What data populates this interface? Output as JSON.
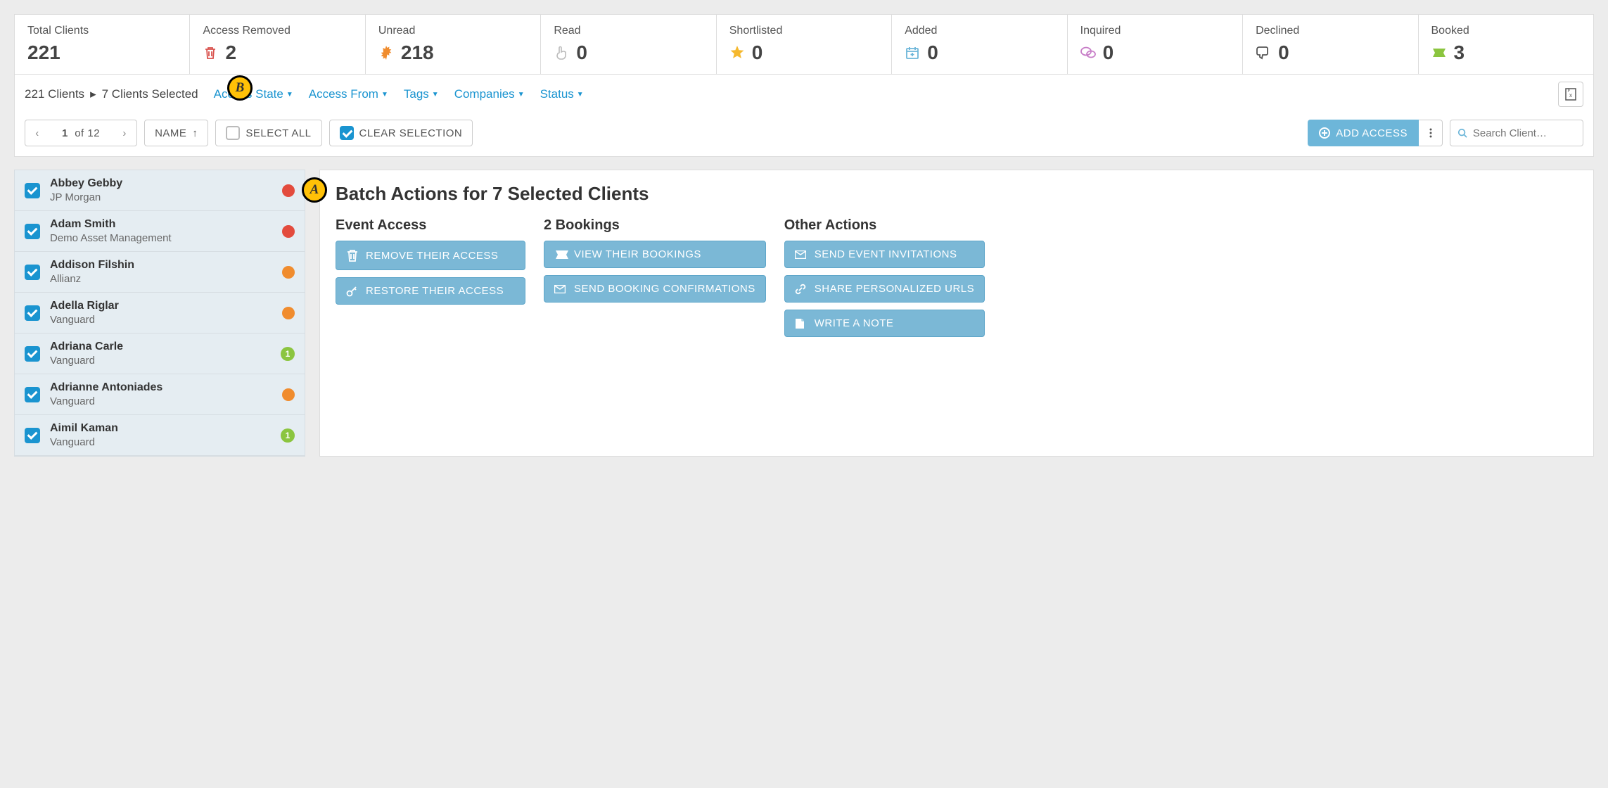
{
  "stats": [
    {
      "label": "Total Clients",
      "value": "221",
      "icon": null,
      "color": null
    },
    {
      "label": "Access Removed",
      "value": "2",
      "icon": "trash-icon",
      "color": "#d9534f"
    },
    {
      "label": "Unread",
      "value": "218",
      "icon": "burst-icon",
      "color": "#f08c2e"
    },
    {
      "label": "Read",
      "value": "0",
      "icon": "pointer-icon",
      "color": "#bbb"
    },
    {
      "label": "Shortlisted",
      "value": "0",
      "icon": "star-icon",
      "color": "#f5b82e"
    },
    {
      "label": "Added",
      "value": "0",
      "icon": "calendar-add-icon",
      "color": "#6db6d9"
    },
    {
      "label": "Inquired",
      "value": "0",
      "icon": "chat-icon",
      "color": "#c77dc7"
    },
    {
      "label": "Declined",
      "value": "0",
      "icon": "thumbs-down-icon",
      "color": "#555"
    },
    {
      "label": "Booked",
      "value": "3",
      "icon": "ticket-icon",
      "color": "#8bc53f"
    }
  ],
  "breadcrumb": {
    "total": "221 Clients",
    "selected": "7 Clients Selected"
  },
  "filters": [
    "Access State",
    "Access From",
    "Tags",
    "Companies",
    "Status"
  ],
  "pager": {
    "page": "1",
    "of": "of 12"
  },
  "sort": {
    "label": "NAME"
  },
  "select_all": "SELECT ALL",
  "clear_selection": "CLEAR SELECTION",
  "add_access": "ADD ACCESS",
  "search_placeholder": "Search Client…",
  "clients": [
    {
      "name": "Abbey Gebby",
      "company": "JP Morgan",
      "status_color": "#e34b3d",
      "badge": null
    },
    {
      "name": "Adam Smith",
      "company": "Demo Asset Management",
      "status_color": "#e34b3d",
      "badge": null
    },
    {
      "name": "Addison Filshin",
      "company": "Allianz",
      "status_color": "#f08c2e",
      "badge": null
    },
    {
      "name": "Adella Riglar",
      "company": "Vanguard",
      "status_color": "#f08c2e",
      "badge": null
    },
    {
      "name": "Adriana Carle",
      "company": "Vanguard",
      "status_color": null,
      "badge": "1"
    },
    {
      "name": "Adrianne Antoniades",
      "company": "Vanguard",
      "status_color": "#f08c2e",
      "badge": null
    },
    {
      "name": "Aimil Kaman",
      "company": "Vanguard",
      "status_color": null,
      "badge": "1"
    }
  ],
  "batch": {
    "title": "Batch Actions for 7 Selected Clients",
    "cols": [
      {
        "title": "Event Access",
        "buttons": [
          {
            "icon": "trash-icon",
            "label": "REMOVE THEIR ACCESS"
          },
          {
            "icon": "key-icon",
            "label": "RESTORE THEIR ACCESS"
          }
        ]
      },
      {
        "title": "2 Bookings",
        "buttons": [
          {
            "icon": "ticket-icon",
            "label": "VIEW THEIR BOOKINGS"
          },
          {
            "icon": "envelope-icon",
            "label": "SEND BOOKING CONFIRMATIONS"
          }
        ]
      },
      {
        "title": "Other Actions",
        "buttons": [
          {
            "icon": "envelope-icon",
            "label": "SEND EVENT INVITATIONS"
          },
          {
            "icon": "link-icon",
            "label": "SHARE PERSONALIZED URLS"
          },
          {
            "icon": "note-icon",
            "label": "WRITE A NOTE"
          }
        ]
      }
    ]
  },
  "annotations": {
    "a": "A",
    "b": "B"
  }
}
